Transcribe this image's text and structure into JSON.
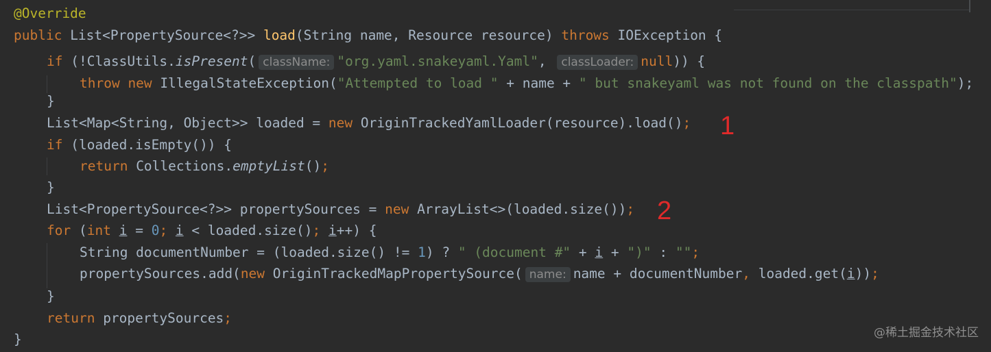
{
  "code": {
    "l1_annotation": "@Override",
    "l2_public": "public",
    "l2_type": " List<PropertySource<?>> ",
    "l2_method": "load",
    "l2_params": "(String name, Resource resource) ",
    "l2_throws": "throws",
    "l2_rest": " IOException {",
    "l3_if": "if",
    "l3_a": " (!ClassUtils.",
    "l3_method": "isPresent",
    "l3_paren": "(",
    "l3_hint1": "className:",
    "l3_str": "\"org.yaml.snakeyaml.Yaml\"",
    "l3_comma": ", ",
    "l3_hint2": "classLoader:",
    "l3_null": "null",
    "l3_end": ")) {",
    "l4_throw": "throw",
    "l4_new": " new",
    "l4_a": " IllegalStateException(",
    "l4_str1": "\"Attempted to load \"",
    "l4_b": " + name + ",
    "l4_str2": "\" but snakeyaml was not found on the classpath\"",
    "l4_end": ");",
    "l5": "}",
    "l6_a": "List<Map<String, Object>> loaded = ",
    "l6_new": "new",
    "l6_b": " OriginTrackedYamlLoader(resource).load()",
    "l6_semi": ";",
    "l7_if": "if",
    "l7_rest": " (loaded.isEmpty()) {",
    "l8_return": "return",
    "l8_a": " Collections.",
    "l8_method": "emptyList",
    "l8_b": "()",
    "l8_semi": ";",
    "l9": "}",
    "l10_a": "List<PropertySource<?>> propertySources = ",
    "l10_new": "new",
    "l10_b": " ArrayList<>(loaded.size())",
    "l10_semi": ";",
    "l11_for": "for",
    "l11_a": " (",
    "l11_int": "int",
    "l11_sp": " ",
    "l11_i1": "i",
    "l11_b": " = ",
    "l11_zero": "0",
    "l11_semi1": "; ",
    "l11_i2": "i",
    "l11_c": " < loaded.size()",
    "l11_semi2": "; ",
    "l11_i3": "i",
    "l11_d": "++) {",
    "l12_a": "String documentNumber = (loaded.size() != ",
    "l12_one": "1",
    "l12_b": ") ? ",
    "l12_str1": "\" (document #\"",
    "l12_c": " + ",
    "l12_i": "i",
    "l12_d": " + ",
    "l12_str2": "\")\"",
    "l12_e": " : ",
    "l12_str3": "\"\"",
    "l12_semi": ";",
    "l13_a": "propertySources.add(",
    "l13_new": "new",
    "l13_b": " OriginTrackedMapPropertySource(",
    "l13_hint": "name:",
    "l13_c": "name + documentNumber",
    "l13_comma": ", ",
    "l13_d": "loaded.get(",
    "l13_i": "i",
    "l13_e": "))",
    "l13_semi": ";",
    "l14": "}",
    "l15_return": "return",
    "l15_rest": " propertySources",
    "l15_semi": ";",
    "l16": "}"
  },
  "markers": {
    "m1": "1",
    "m2": "2"
  },
  "watermark": "@稀土掘金技术社区",
  "colors": {
    "background": "#2b2b2b",
    "keyword": "#cc7832",
    "string": "#6a8759",
    "number": "#6897bb",
    "method": "#ffc66d",
    "annotation": "#bbb529",
    "marker": "#e02a2a"
  }
}
